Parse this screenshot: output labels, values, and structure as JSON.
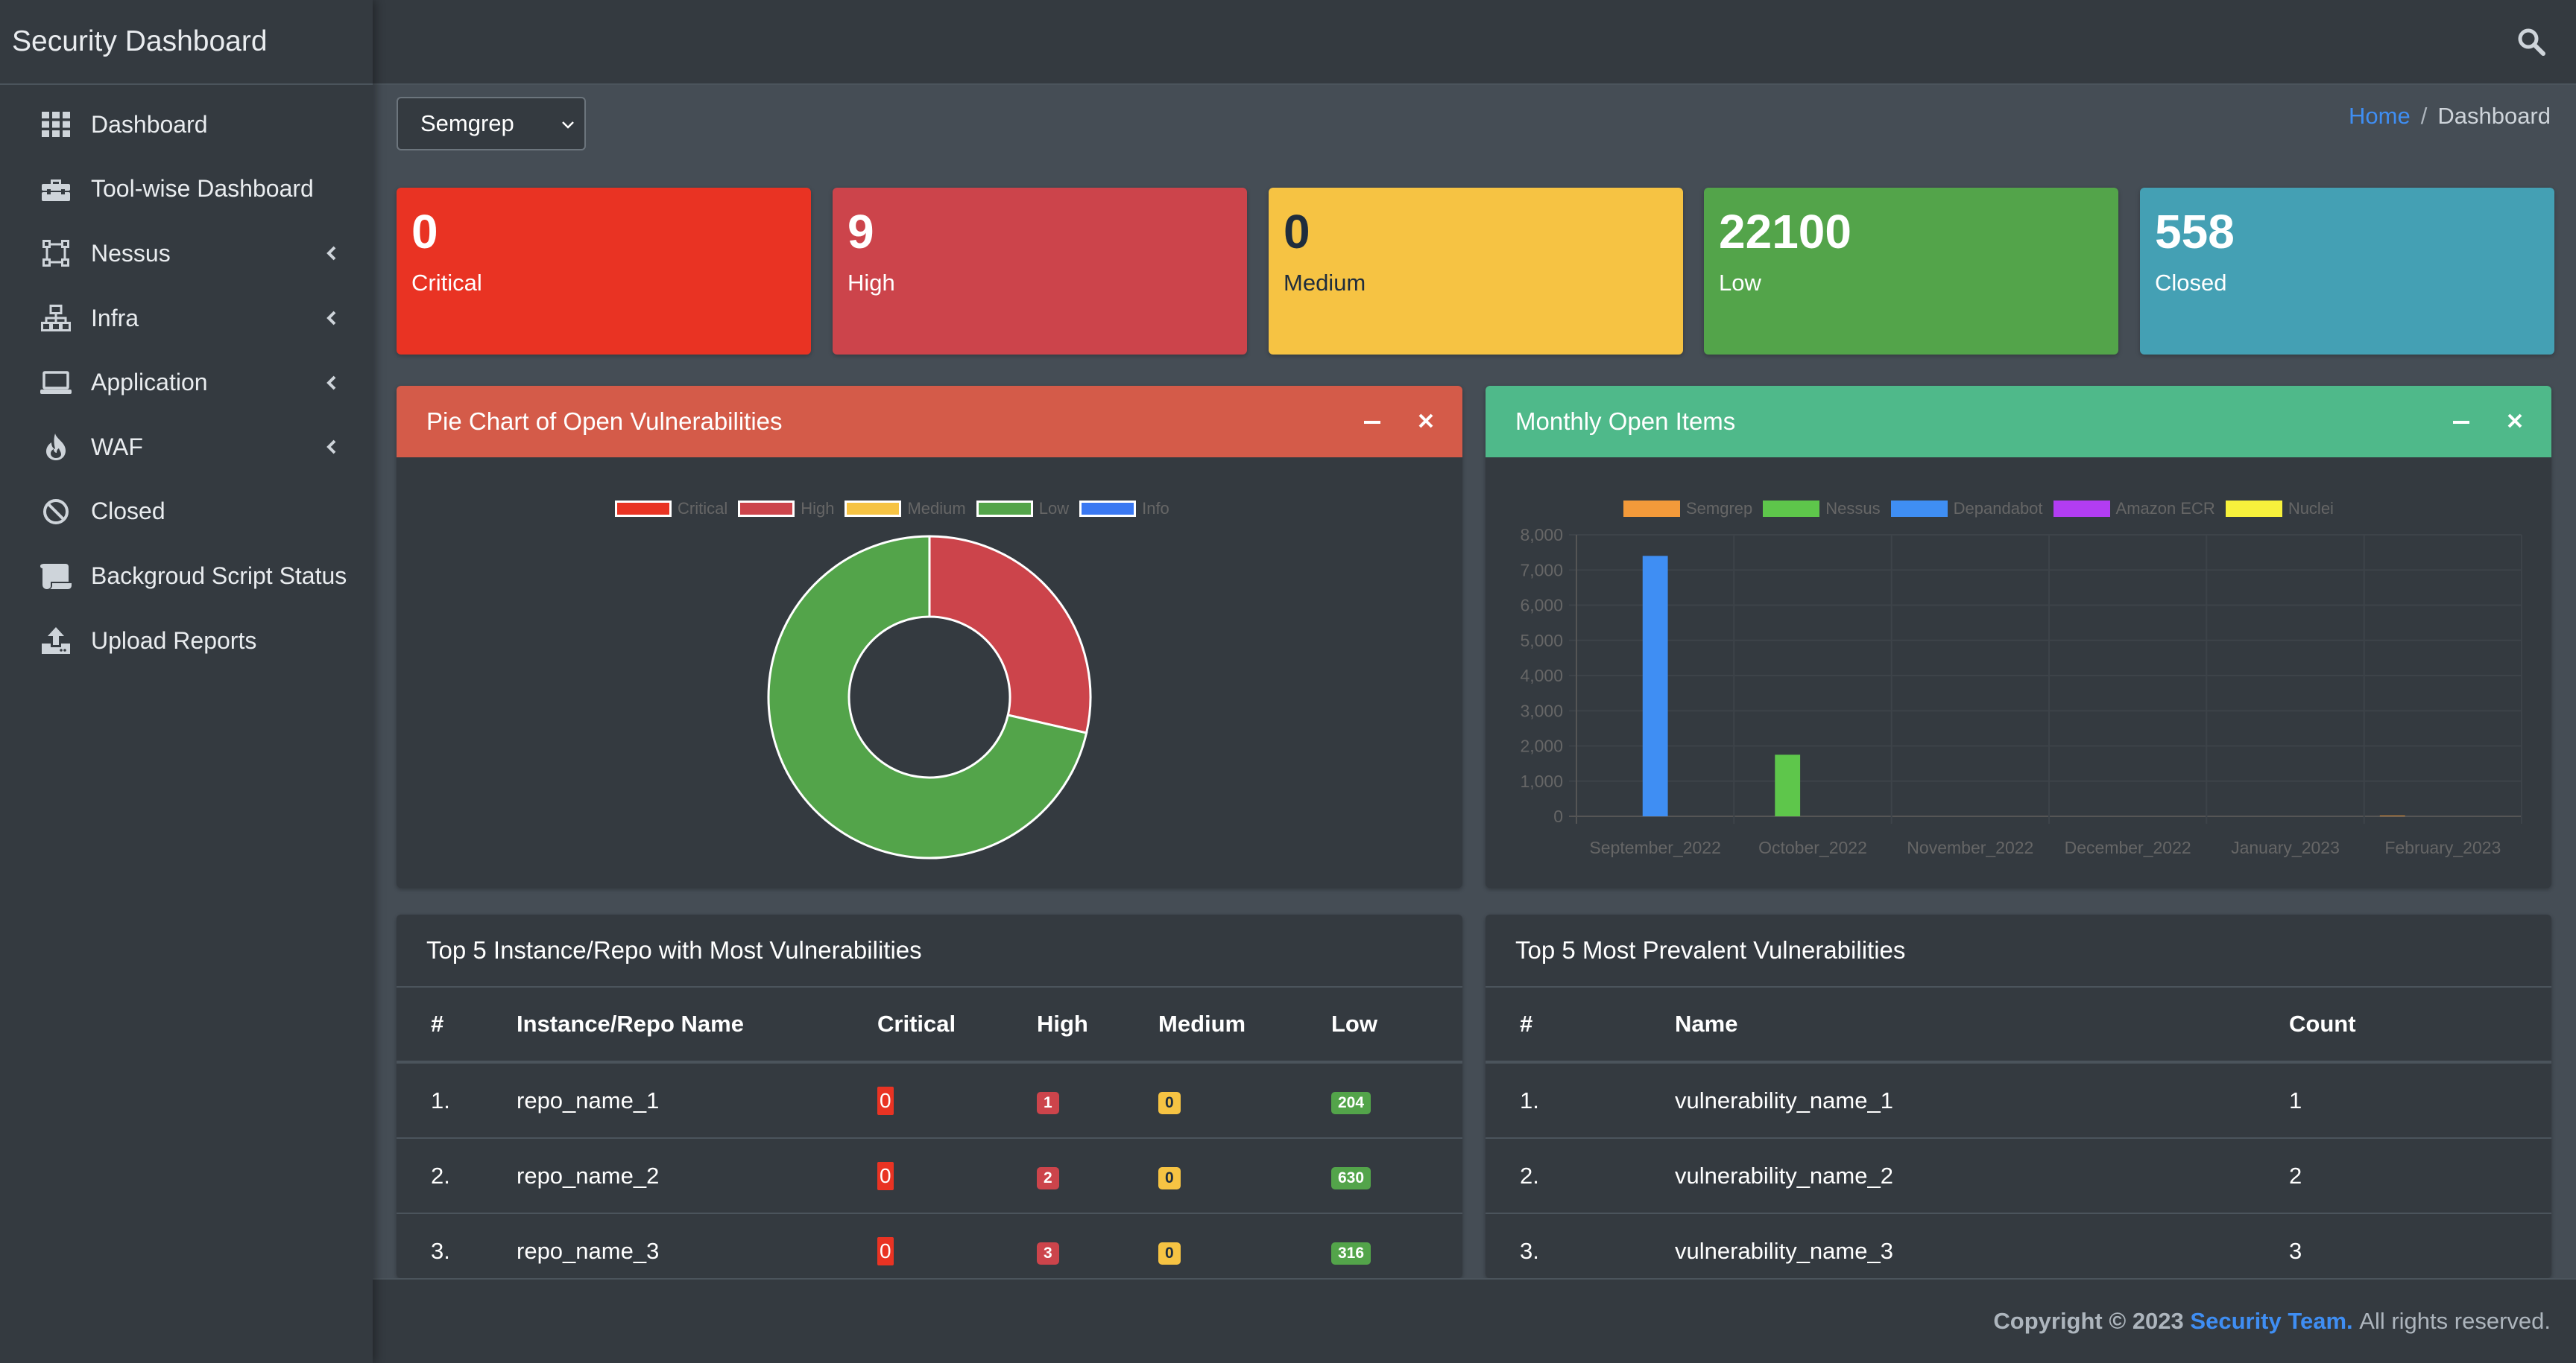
{
  "brand": "Security Dashboard",
  "sidebar": {
    "items": [
      {
        "label": "Dashboard",
        "icon": "grid-icon"
      },
      {
        "label": "Tool-wise Dashboard",
        "icon": "toolbox-icon"
      },
      {
        "label": "Nessus",
        "icon": "vector-square-icon",
        "expandable": true
      },
      {
        "label": "Infra",
        "icon": "network-icon",
        "expandable": true
      },
      {
        "label": "Application",
        "icon": "laptop-icon",
        "expandable": true
      },
      {
        "label": "WAF",
        "icon": "fire-icon",
        "expandable": true
      },
      {
        "label": "Closed",
        "icon": "ban-icon"
      },
      {
        "label": "Backgroud Script Status",
        "icon": "scroll-icon"
      },
      {
        "label": "Upload Reports",
        "icon": "upload-icon"
      }
    ]
  },
  "toolbar": {
    "tool_select_value": "Semgrep"
  },
  "breadcrumb": {
    "home": "Home",
    "separator": "/",
    "active": "Dashboard"
  },
  "stats": [
    {
      "value": "0",
      "label": "Critical",
      "color": "#e93323"
    },
    {
      "value": "9",
      "label": "High",
      "color": "#cc444b"
    },
    {
      "value": "0",
      "label": "Medium",
      "color": "#f6c343"
    },
    {
      "value": "22100",
      "label": "Low",
      "color": "#53a44a"
    },
    {
      "value": "558",
      "label": "Closed",
      "color": "#44a0b4"
    }
  ],
  "pie_card": {
    "title": "Pie Chart of Open Vulnerabilities",
    "header_color": "#d45b49"
  },
  "bar_card": {
    "title": "Monthly Open Items",
    "header_color": "#4fb98a"
  },
  "chart_data": [
    {
      "type": "pie",
      "variant": "doughnut",
      "legend": [
        {
          "name": "Critical",
          "color": "#e93323"
        },
        {
          "name": "High",
          "color": "#cc444b"
        },
        {
          "name": "Medium",
          "color": "#f6c343"
        },
        {
          "name": "Low",
          "color": "#53a44a"
        },
        {
          "name": "Info",
          "color": "#3a78f2"
        }
      ],
      "slices": [
        {
          "name": "Critical",
          "value": 0
        },
        {
          "name": "High",
          "value": 9
        },
        {
          "name": "Medium",
          "value": 0
        },
        {
          "name": "Low",
          "value": 22.5
        },
        {
          "name": "Info",
          "value": 0
        }
      ],
      "legend_position": "top"
    },
    {
      "type": "bar",
      "categories": [
        "September_2022",
        "October_2022",
        "November_2022",
        "December_2022",
        "January_2023",
        "February_2023"
      ],
      "series": [
        {
          "name": "Semgrep",
          "color": "#f39a3a",
          "values": [
            0,
            0,
            0,
            0,
            0,
            20
          ]
        },
        {
          "name": "Nessus",
          "color": "#5ec64b",
          "values": [
            0,
            1750,
            0,
            0,
            0,
            0
          ]
        },
        {
          "name": "Depandabot",
          "color": "#3f8ef3",
          "values": [
            7400,
            0,
            0,
            0,
            0,
            0
          ]
        },
        {
          "name": "Amazon ECR",
          "color": "#b23df2",
          "values": [
            0,
            0,
            0,
            0,
            0,
            0
          ]
        },
        {
          "name": "Nuclei",
          "color": "#f7f13c",
          "values": [
            0,
            0,
            0,
            0,
            0,
            0
          ]
        }
      ],
      "yticks": [
        "0",
        "1,000",
        "2,000",
        "3,000",
        "4,000",
        "5,000",
        "6,000",
        "7,000",
        "8,000"
      ],
      "ylim": [
        0,
        8000
      ],
      "grid": true,
      "legend_position": "top"
    }
  ],
  "repo_table": {
    "title": "Top 5 Instance/Repo with Most Vulnerabilities",
    "headers": [
      "#",
      "Instance/Repo Name",
      "Critical",
      "High",
      "Medium",
      "Low"
    ],
    "rows": [
      {
        "idx": "1.",
        "name": "repo_name_1",
        "critical": "0",
        "high": "1",
        "medium": "0",
        "low": "204"
      },
      {
        "idx": "2.",
        "name": "repo_name_2",
        "critical": "0",
        "high": "2",
        "medium": "0",
        "low": "630"
      },
      {
        "idx": "3.",
        "name": "repo_name_3",
        "critical": "0",
        "high": "3",
        "medium": "0",
        "low": "316"
      }
    ]
  },
  "vuln_table": {
    "title": "Top 5 Most Prevalent Vulnerabilities",
    "headers": [
      "#",
      "Name",
      "Count"
    ],
    "rows": [
      {
        "idx": "1.",
        "name": "vulnerability_name_1",
        "count": "1"
      },
      {
        "idx": "2.",
        "name": "vulnerability_name_2",
        "count": "2"
      },
      {
        "idx": "3.",
        "name": "vulnerability_name_3",
        "count": "3"
      }
    ]
  },
  "footer": {
    "prefix": "Copyright © 2023",
    "team": "Security Team.",
    "suffix": "All rights reserved."
  }
}
